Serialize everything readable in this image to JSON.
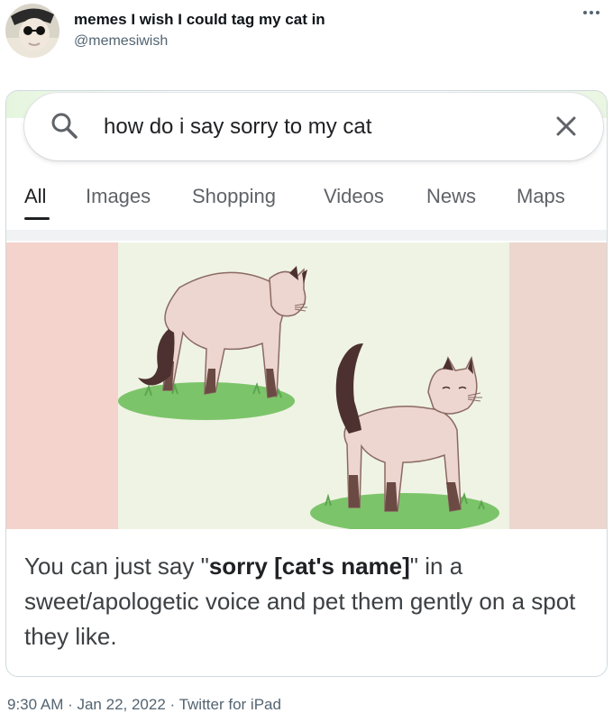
{
  "tweet": {
    "display_name": "memes I wish I could tag my cat in",
    "handle": "@memesiwish",
    "more_icon": "more-horizontal-icon"
  },
  "search": {
    "query": "how do i say sorry to my cat",
    "search_icon": "search-icon",
    "clear_icon": "close-icon",
    "tabs": [
      "All",
      "Images",
      "Shopping",
      "Videos",
      "News",
      "Maps"
    ],
    "active_tab": "All"
  },
  "result": {
    "answer_prefix": "You can just say \"",
    "answer_bold": "sorry [cat's name]",
    "answer_suffix": "\" in a sweet/apologetic voice and pet them gently on a spot they like."
  },
  "footer": {
    "meta": "9:30 AM · Jan 22, 2022 · Twitter for iPad"
  },
  "colors": {
    "handle_gray": "#536471",
    "card_border": "#cfd9de",
    "tab_gray": "#5f6368",
    "text_dark": "#202124"
  }
}
